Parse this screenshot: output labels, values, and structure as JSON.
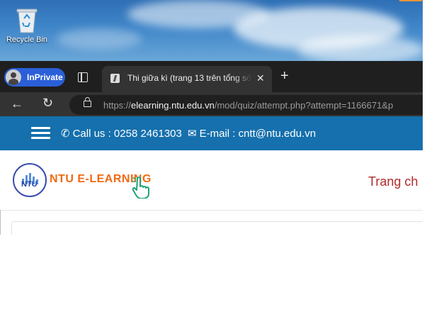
{
  "desktop": {
    "recycle_bin_label": "Recycle Bin"
  },
  "browser": {
    "inprivate_label": "InPrivate",
    "tab_title": "Thi giữa kì (trang 13 trên tổng số",
    "tab_close": "✕",
    "new_tab": "+",
    "url_prefix": "https://",
    "url_host": "elearning.ntu.edu.vn",
    "url_path": "/mod/quiz/attempt.php?attempt=1166671&p"
  },
  "site": {
    "phone_text": "Call us : 0258 2461303",
    "email_text": "E-mail : cntt@ntu.edu.vn",
    "brand_text": "NTU E-LEARNING",
    "logo_text": "NTU",
    "nav_home": "Trang ch",
    "topbar_color": "#1570ad",
    "brand_color": "#f06a12",
    "nav_color": "#b02a2a"
  },
  "icons": [
    "recycle-bin-icon",
    "tabs-icon",
    "favicon-icon",
    "close-icon",
    "new-tab-icon",
    "back-icon",
    "reload-icon",
    "lock-icon",
    "hamburger-icon",
    "phone-icon",
    "mail-icon",
    "hand-pointer-icon"
  ]
}
